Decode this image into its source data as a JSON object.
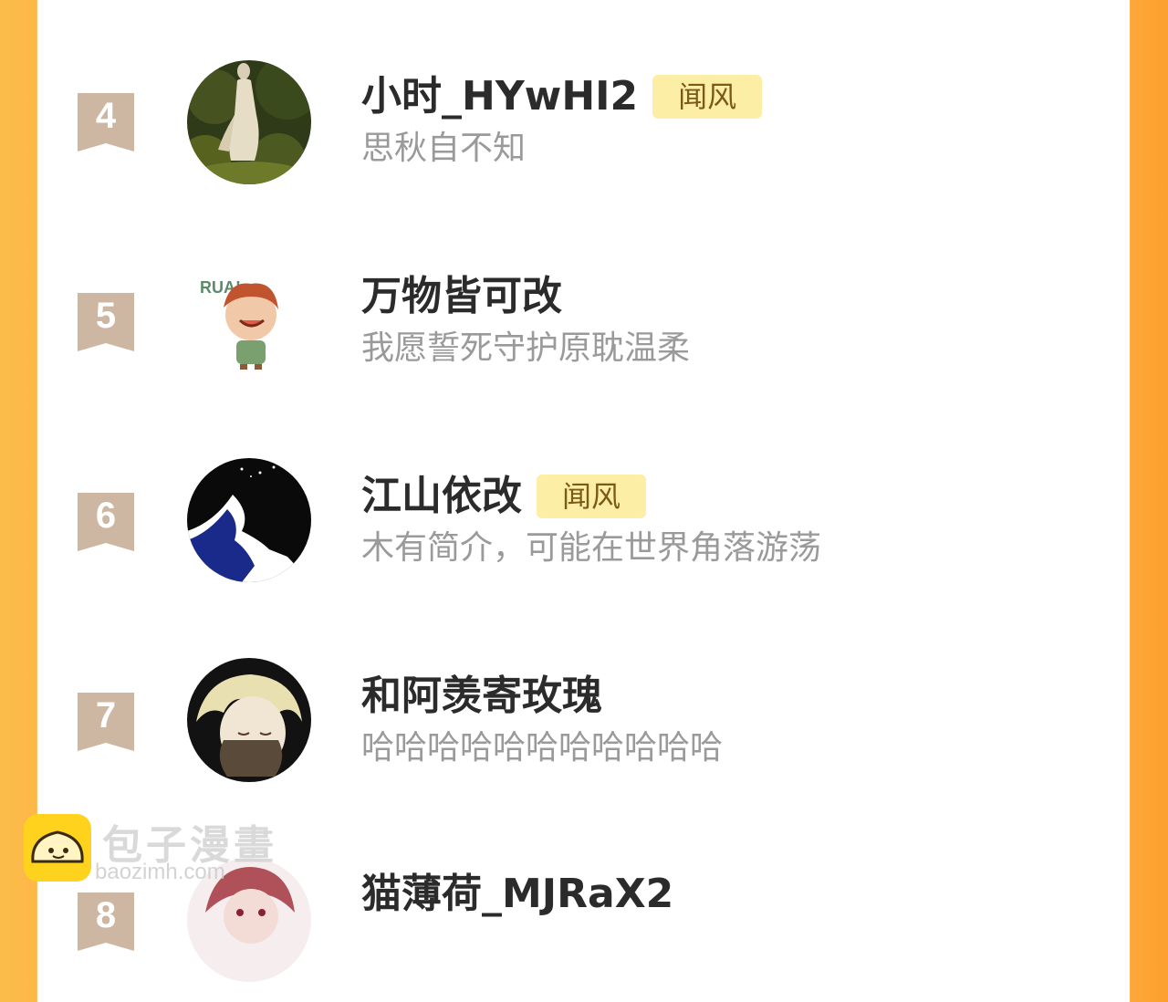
{
  "entries": [
    {
      "rank": "4",
      "name": "小时_HYwHI2",
      "badge": "闻风",
      "bio": "思秋自不知",
      "avatar": "avatar-forest-figure"
    },
    {
      "rank": "5",
      "name": "万物皆可改",
      "badge": "",
      "bio": "我愿誓死守护原耽温柔",
      "avatar": "avatar-cartoon-boy",
      "avatar_text": "RUA!"
    },
    {
      "rank": "6",
      "name": "江山依改",
      "badge": "闻风",
      "bio": "木有简介，可能在世界角落游荡",
      "avatar": "avatar-blue-silhouette"
    },
    {
      "rank": "7",
      "name": "和阿羡寄玫瑰",
      "badge": "",
      "bio": "哈哈哈哈哈哈哈哈哈哈哈",
      "avatar": "avatar-anime-blonde"
    },
    {
      "rank": "8",
      "name": "猫薄荷_MJRaX2",
      "badge": "",
      "bio": "",
      "avatar": "avatar-anime-redhair"
    }
  ],
  "watermark": {
    "text": "包子漫畫",
    "url": "baozimh.com",
    "icon": "bun-logo-icon"
  },
  "colors": {
    "frame_orange": "#fda83a",
    "rank_ribbon": "#cdb7a2",
    "badge_bg": "#fdeea6"
  }
}
